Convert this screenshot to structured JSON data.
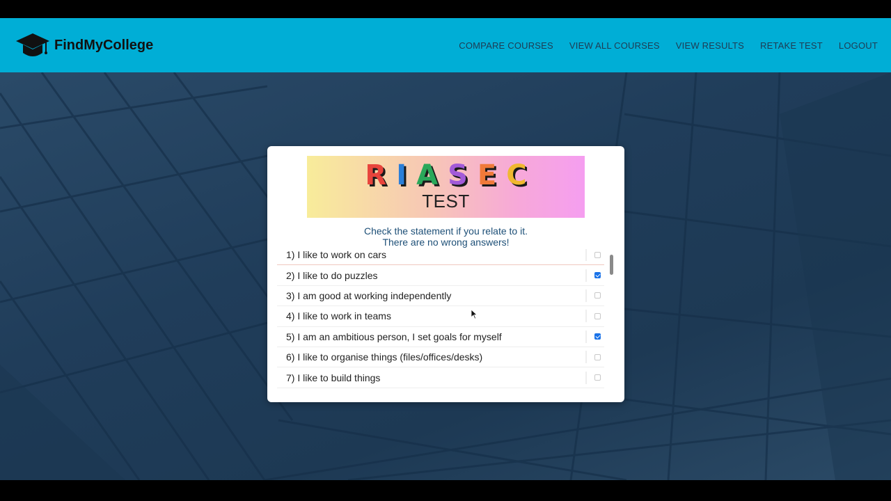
{
  "brand": {
    "name": "FindMyCollege"
  },
  "nav": {
    "links": [
      "COMPARE COURSES",
      "VIEW ALL COURSES",
      "VIEW RESULTS",
      "RETAKE TEST",
      "LOGOUT"
    ]
  },
  "banner": {
    "letters": [
      "R",
      "I",
      "A",
      "S",
      "E",
      "C"
    ],
    "letter_colors": [
      "#e8443c",
      "#2b7fd8",
      "#2aa85a",
      "#a25ad8",
      "#f07a3a",
      "#f0b830"
    ],
    "subtitle": "TEST"
  },
  "instructions": {
    "line1": "Check the statement if you relate to it.",
    "line2": "There are no wrong answers!"
  },
  "questions": [
    {
      "text": "1) I like to work on cars",
      "checked": false
    },
    {
      "text": "2) I like to do puzzles",
      "checked": true
    },
    {
      "text": "3) I am good at working independently",
      "checked": false
    },
    {
      "text": "4) I like to work in teams",
      "checked": false
    },
    {
      "text": "5) I am an ambitious person, I set goals for myself",
      "checked": true
    },
    {
      "text": "6) I like to organise things (files/offices/desks)",
      "checked": false
    },
    {
      "text": "7) I like to build things",
      "checked": false
    }
  ],
  "colors": {
    "navbar": "#00aed6",
    "accent": "#1a73e8",
    "instruction_text": "#1d4f77"
  }
}
